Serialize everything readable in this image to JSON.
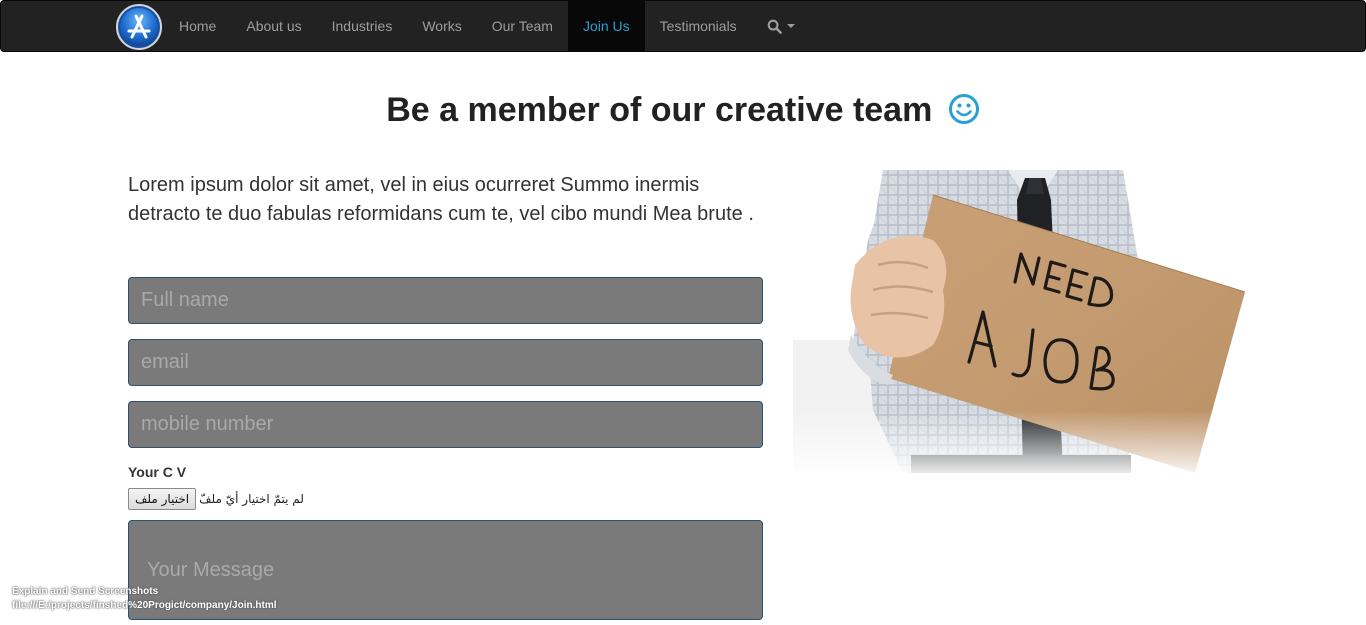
{
  "nav": {
    "items": [
      {
        "label": "Home",
        "active": false
      },
      {
        "label": "About us",
        "active": false
      },
      {
        "label": "Industries",
        "active": false
      },
      {
        "label": "Works",
        "active": false
      },
      {
        "label": "Our Team",
        "active": false
      },
      {
        "label": "Join Us",
        "active": true
      },
      {
        "label": "Testimonials",
        "active": false
      }
    ],
    "search_icon": "search-icon",
    "logo_icon": "app-store-logo-icon",
    "background_color": "#222222",
    "active_color": "#2a9fd6"
  },
  "page": {
    "title": "Be a member of our creative team",
    "title_icon": "smiley-icon",
    "lead": "Lorem ipsum dolor sit amet, vel in eius ocurreret Summo inermis detracto te duo fabulas reformidans cum te, vel cibo mundi Mea brute ."
  },
  "form": {
    "full_name_placeholder": "Full name",
    "email_placeholder": "email",
    "mobile_placeholder": "mobile number",
    "cv_label": "Your C V",
    "file_button_label": "اختيار ملف",
    "file_status": "لم يتمّ اختيار أيّ ملفّ",
    "message_placeholder": "Your Message",
    "field_background": "#7a7a7a"
  },
  "image": {
    "sign_text_line1": "NEED",
    "sign_text_line2": "A JOB"
  },
  "status_overlay": {
    "line1": "Explain and Send Screenshots",
    "line2": "file:///E:/projects/finshed%20Progict/company/Join.html"
  }
}
